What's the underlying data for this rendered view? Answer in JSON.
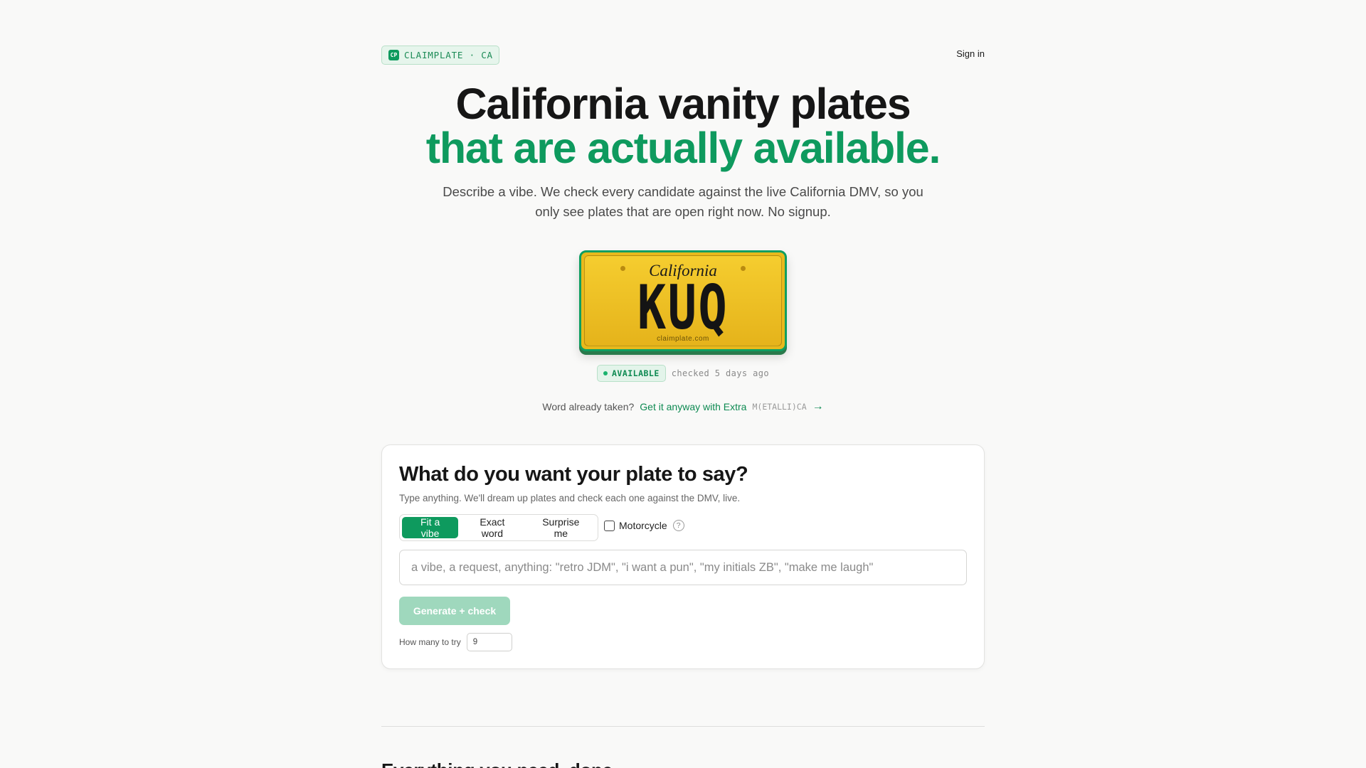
{
  "header": {
    "brand_logo": "CP",
    "brand_text": "CLAIMPLATE · CA",
    "sign_in": "Sign in"
  },
  "hero": {
    "title_line1": "California vanity plates",
    "title_line2": "that are actually available.",
    "subtitle": "Describe a vibe. We check every candidate against the live California DMV, so you only see plates that are open right now. No signup."
  },
  "plate": {
    "state": "California",
    "text": "KUQ",
    "footer": "claimplate.com"
  },
  "status": {
    "badge": "AVAILABLE",
    "checked": "checked 5 days ago"
  },
  "extra": {
    "question": "Word already taken?",
    "link": "Get it anyway with Extra",
    "code": "M(ETALLI)CA",
    "arrow": "→"
  },
  "card": {
    "title": "What do you want your plate to say?",
    "subtitle": "Type anything. We'll dream up plates and check each one against the DMV, live.",
    "modes": [
      "Fit a vibe",
      "Exact word",
      "Surprise me"
    ],
    "selected_mode": "Fit a vibe",
    "motorcycle_label": "Motorcycle",
    "motorcycle_checked": false,
    "help_glyph": "?",
    "prompt_placeholder": "a vibe, a request, anything: \"retro JDM\", \"i want a pun\", \"my initials ZB\", \"make me laugh\"",
    "prompt_value": "",
    "generate_label": "Generate + check",
    "how_many_label": "How many to try",
    "how_many_value": "9"
  },
  "next_section": {
    "heading": "Everything you need, done."
  },
  "colors": {
    "accent": "#0e9a5e",
    "plate_yellow": "#f0c323",
    "background": "#f9f9f8"
  }
}
